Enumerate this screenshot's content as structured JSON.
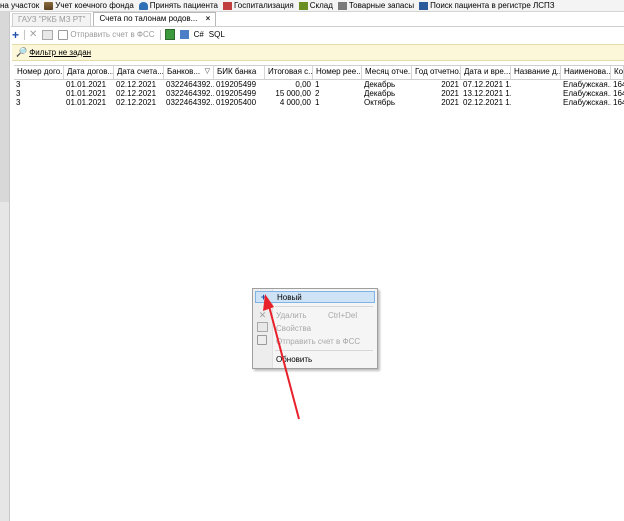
{
  "topbar": {
    "items": [
      {
        "label": "на участок",
        "icon": "none"
      },
      {
        "label": "Учет коечного фонда",
        "icon": "bed-icon"
      },
      {
        "label": "Принять пациента",
        "icon": "patient-icon"
      },
      {
        "label": "Госпитализация",
        "icon": "hospital-icon"
      },
      {
        "label": "Склад",
        "icon": "store-icon"
      },
      {
        "label": "Товарные запасы",
        "icon": "goods-icon"
      },
      {
        "label": "Поиск пациента в регистре ЛСПЗ",
        "icon": "find-icon"
      }
    ]
  },
  "tabs": [
    {
      "label": "ГАУЗ \"РКБ МЗ РТ\"",
      "active": false
    },
    {
      "label": "Счета по талонам родов...",
      "active": true,
      "close": "×"
    }
  ],
  "toolbar": {
    "add": "+",
    "delete": "✕",
    "send_label": "Отправить счет в ФСС",
    "csharp": "C#",
    "sql": "SQL"
  },
  "filter": {
    "label": "Фильтр не задан"
  },
  "grid": {
    "columns": [
      "Номер дого...",
      "Дата догов...",
      "Дата счета...",
      "Банков...",
      "БИК банка",
      "Итоговая с...",
      "Номер рее...",
      "Месяц отче...",
      "Год отчетно...",
      "Дата и вре...",
      "Название д...",
      "Наименова...",
      "Ко"
    ],
    "rows": [
      [
        "3",
        "01.01.2021",
        "02.12.2021",
        "0322464392...",
        "019205499",
        "0,00",
        "1",
        "Декабрь",
        "2021",
        "07.12.2021 1...",
        "",
        "Елабужская...",
        "164"
      ],
      [
        "3",
        "01.01.2021",
        "02.12.2021",
        "0322464392...",
        "019205499",
        "15 000,00",
        "2",
        "Декабрь",
        "2021",
        "13.12.2021 1...",
        "",
        "Елабужская...",
        "164"
      ],
      [
        "3",
        "01.01.2021",
        "02.12.2021",
        "0322464392...",
        "019205400",
        "4 000,00",
        "1",
        "Октябрь",
        "2021",
        "02.12.2021 1...",
        "",
        "Елабужская...",
        "164"
      ]
    ]
  },
  "context_menu": {
    "new": "Новый",
    "delete": "Удалить",
    "delete_shortcut": "Ctrl+Del",
    "properties": "Свойства",
    "send": "Отправить счет в ФСС",
    "refresh": "Обновить"
  },
  "colors": {
    "accent": "#1f4fa8",
    "arrow": "#e8202a",
    "highlight": "#cfe3f7",
    "filter_bg": "#fbf7d8"
  }
}
